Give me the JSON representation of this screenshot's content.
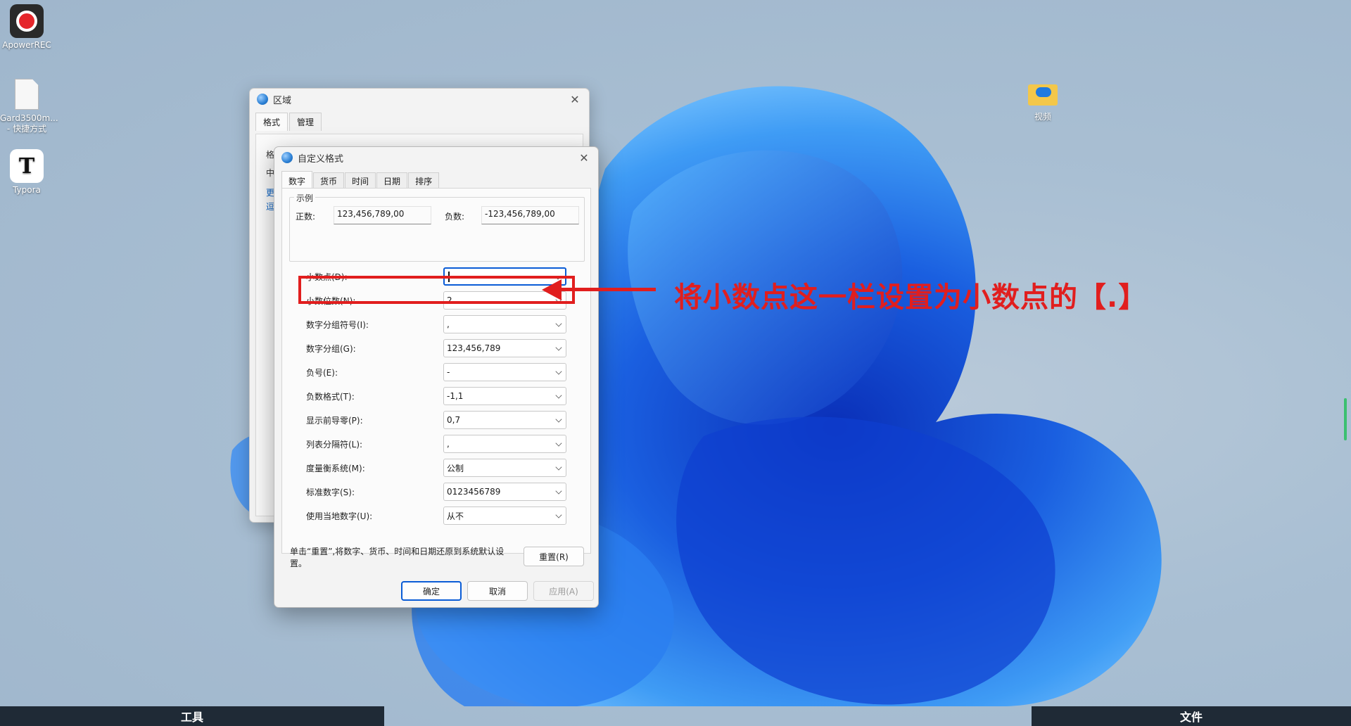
{
  "desktop": {
    "icons": [
      {
        "label": "ApowerREC",
        "icon": "apowerrec-icon"
      },
      {
        "label": "Gard3500m...\n- 快捷方式",
        "icon": "file-shortcut-icon"
      },
      {
        "label": "Typora",
        "icon": "typora-icon"
      },
      {
        "label": "视频",
        "icon": "folder-icon"
      }
    ]
  },
  "bg_window": {
    "title": "区域",
    "tabs": [
      "格式",
      "管理"
    ],
    "fragments": [
      "格",
      "中",
      "更",
      "逗"
    ]
  },
  "dialog": {
    "title": "自定义格式",
    "tabs": [
      "数字",
      "货币",
      "时间",
      "日期",
      "排序"
    ],
    "sample": {
      "legend": "示例",
      "positive_label": "正数:",
      "positive_value": "123,456,789,00",
      "negative_label": "负数:",
      "negative_value": "-123,456,789,00"
    },
    "rows": [
      {
        "label": "小数点(D):",
        "value": ""
      },
      {
        "label": "小数位数(N):",
        "value": "2"
      },
      {
        "label": "数字分组符号(I):",
        "value": ","
      },
      {
        "label": "数字分组(G):",
        "value": "123,456,789"
      },
      {
        "label": "负号(E):",
        "value": "-"
      },
      {
        "label": "负数格式(T):",
        "value": "-1,1"
      },
      {
        "label": "显示前导零(P):",
        "value": "0,7"
      },
      {
        "label": "列表分隔符(L):",
        "value": ","
      },
      {
        "label": "度量衡系统(M):",
        "value": "公制"
      },
      {
        "label": "标准数字(S):",
        "value": "0123456789"
      },
      {
        "label": "使用当地数字(U):",
        "value": "从不"
      }
    ],
    "reset_note": "单击“重置”,将数字、货币、时间和日期还原到系统默认设置。",
    "reset_button": "重置(R)",
    "ok_button": "确定",
    "cancel_button": "取消",
    "apply_button": "应用(A)"
  },
  "annotation": {
    "text": "将小数点这一栏设置为小数点的【.】",
    "color": "#e11e1e"
  },
  "bottom_bars": {
    "left": "工具",
    "right": "文件"
  }
}
